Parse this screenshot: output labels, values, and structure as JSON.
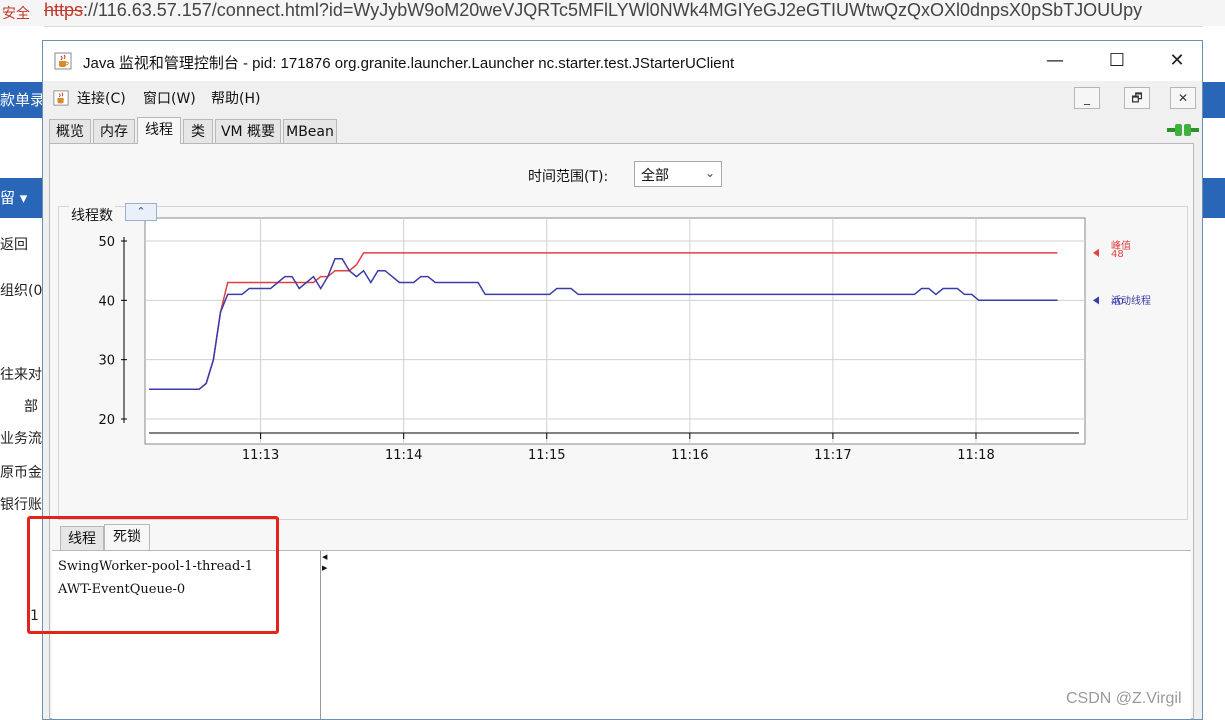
{
  "browser": {
    "security_label": "安全",
    "url_scheme": "https",
    "url_rest": "://116.63.57.157/connect.html?id=WyJybW9oM20weVJQRTc5MFlLYWl0NWk4MGIYeGJ2eGTIUWtwQzQxOXl0dnpsX0pSbTJOUUpy"
  },
  "background_page": {
    "left_items": [
      "款单录",
      "留 ▾",
      "返回",
      "组织(0",
      "往来对",
      "部",
      "业务流",
      "原币金",
      "银行账"
    ],
    "row_number": "1"
  },
  "window": {
    "title": "Java 监视和管理控制台 - pid: 171876 org.granite.launcher.Launcher nc.starter.test.JStarterUClient",
    "minimize_glyph": "—",
    "maximize_glyph": "☐",
    "close_glyph": "✕"
  },
  "menu": {
    "items": [
      "连接(C)",
      "窗口(W)",
      "帮助(H)"
    ],
    "mdi_buttons": [
      "_",
      "🗗",
      "✕"
    ]
  },
  "tabs": [
    "概览",
    "内存",
    "线程",
    "类",
    "VM 概要",
    "MBean"
  ],
  "active_tab": "线程",
  "time_range": {
    "label": "时间范围(T):",
    "value": "全部"
  },
  "chart_data": {
    "type": "line",
    "title": "线程数",
    "xlabel": "",
    "ylabel": "",
    "ylim": [
      20,
      50
    ],
    "yticks": [
      20,
      30,
      40,
      50
    ],
    "xticks": [
      "11:13",
      "11:14",
      "11:15",
      "11:16",
      "11:17",
      "11:18"
    ],
    "x_minutes": [
      12.22,
      12.27,
      12.42,
      12.52,
      12.57,
      12.62,
      12.67,
      12.72,
      12.77,
      12.82,
      12.87,
      12.92,
      12.97,
      13.02,
      13.07,
      13.12,
      13.17,
      13.22,
      13.27,
      13.32,
      13.37,
      13.42,
      13.47,
      13.52,
      13.57,
      13.62,
      13.67,
      13.72,
      13.77,
      13.82,
      13.87,
      13.92,
      13.97,
      14.02,
      14.07,
      14.12,
      14.17,
      14.22,
      14.27,
      14.32,
      14.37,
      14.42,
      14.47,
      14.52,
      14.57,
      14.62,
      14.67,
      14.72,
      14.77,
      14.82,
      14.87,
      14.92,
      14.97,
      15.02,
      15.07,
      15.12,
      15.17,
      15.22,
      15.27,
      15.32,
      15.37,
      15.42,
      15.47,
      15.52,
      15.57,
      15.62,
      15.67,
      15.72,
      15.77,
      15.82,
      15.87,
      15.92,
      15.97,
      16.02,
      16.07,
      16.12,
      16.17,
      16.22,
      16.27,
      16.32,
      16.37,
      16.42,
      16.47,
      16.52,
      16.57,
      16.62,
      16.67,
      16.72,
      16.77,
      16.82,
      16.87,
      16.92,
      16.97,
      17.02,
      17.07,
      17.12,
      17.17,
      17.22,
      17.27,
      17.32,
      17.37,
      17.42,
      17.47,
      17.52,
      17.57,
      17.62,
      17.67,
      17.72,
      17.77,
      17.82,
      17.87,
      17.92,
      17.97,
      18.02,
      18.07,
      18.12,
      18.17,
      18.22,
      18.27,
      18.32,
      18.37,
      18.42,
      18.47,
      18.52,
      18.57,
      18.62,
      18.67,
      18.72
    ],
    "series": [
      {
        "name": "峰值",
        "color": "#e04040",
        "values": [
          25,
          25,
          25,
          25,
          25,
          26,
          30,
          38,
          43,
          43,
          43,
          43,
          43,
          43,
          43,
          43,
          43,
          43,
          43,
          43,
          43,
          44,
          44,
          45,
          45,
          45,
          46,
          48,
          48,
          48,
          48,
          48,
          48,
          48,
          48,
          48,
          48,
          48,
          48,
          48,
          48,
          48,
          48,
          48,
          48,
          48,
          48,
          48,
          48,
          48,
          48,
          48,
          48,
          48,
          48,
          48,
          48,
          48,
          48,
          48,
          48,
          48,
          48,
          48,
          48,
          48,
          48,
          48,
          48,
          48,
          48,
          48,
          48,
          48,
          48,
          48,
          48,
          48,
          48,
          48,
          48,
          48,
          48,
          48,
          48,
          48,
          48,
          48,
          48,
          48,
          48,
          48,
          48,
          48,
          48,
          48,
          48,
          48,
          48,
          48,
          48,
          48,
          48,
          48,
          48,
          48,
          48,
          48,
          48,
          48,
          48,
          48,
          48,
          48,
          48,
          48,
          48,
          48,
          48,
          48,
          48,
          48,
          48,
          48,
          48
        ],
        "current_label": "48"
      },
      {
        "name": "活动线程",
        "color": "#3c3ca8",
        "values": [
          25,
          25,
          25,
          25,
          25,
          26,
          30,
          38,
          41,
          41,
          41,
          42,
          42,
          42,
          42,
          43,
          44,
          44,
          42,
          43,
          44,
          42,
          44,
          47,
          47,
          45,
          44,
          45,
          43,
          45,
          45,
          44,
          43,
          43,
          43,
          44,
          44,
          43,
          43,
          43,
          43,
          43,
          43,
          43,
          41,
          41,
          41,
          41,
          41,
          41,
          41,
          41,
          41,
          41,
          42,
          42,
          42,
          41,
          41,
          41,
          41,
          41,
          41,
          41,
          41,
          41,
          41,
          41,
          41,
          41,
          41,
          41,
          41,
          41,
          41,
          41,
          41,
          41,
          41,
          41,
          41,
          41,
          41,
          41,
          41,
          41,
          41,
          41,
          41,
          41,
          41,
          41,
          41,
          41,
          41,
          41,
          41,
          41,
          41,
          41,
          41,
          41,
          41,
          41,
          41,
          42,
          42,
          41,
          42,
          42,
          42,
          41,
          41,
          40,
          40,
          40,
          40,
          40,
          40,
          40,
          40,
          40,
          40,
          40,
          40
        ],
        "current_label": "40"
      }
    ],
    "grid": true,
    "legend_placement": "right"
  },
  "detail_tabs": [
    "线程",
    "死锁"
  ],
  "active_detail_tab": "死锁",
  "threads": [
    "SwingWorker-pool-1-thread-1",
    "AWT-EventQueue-0"
  ],
  "watermark": "CSDN @Z.Virgil"
}
